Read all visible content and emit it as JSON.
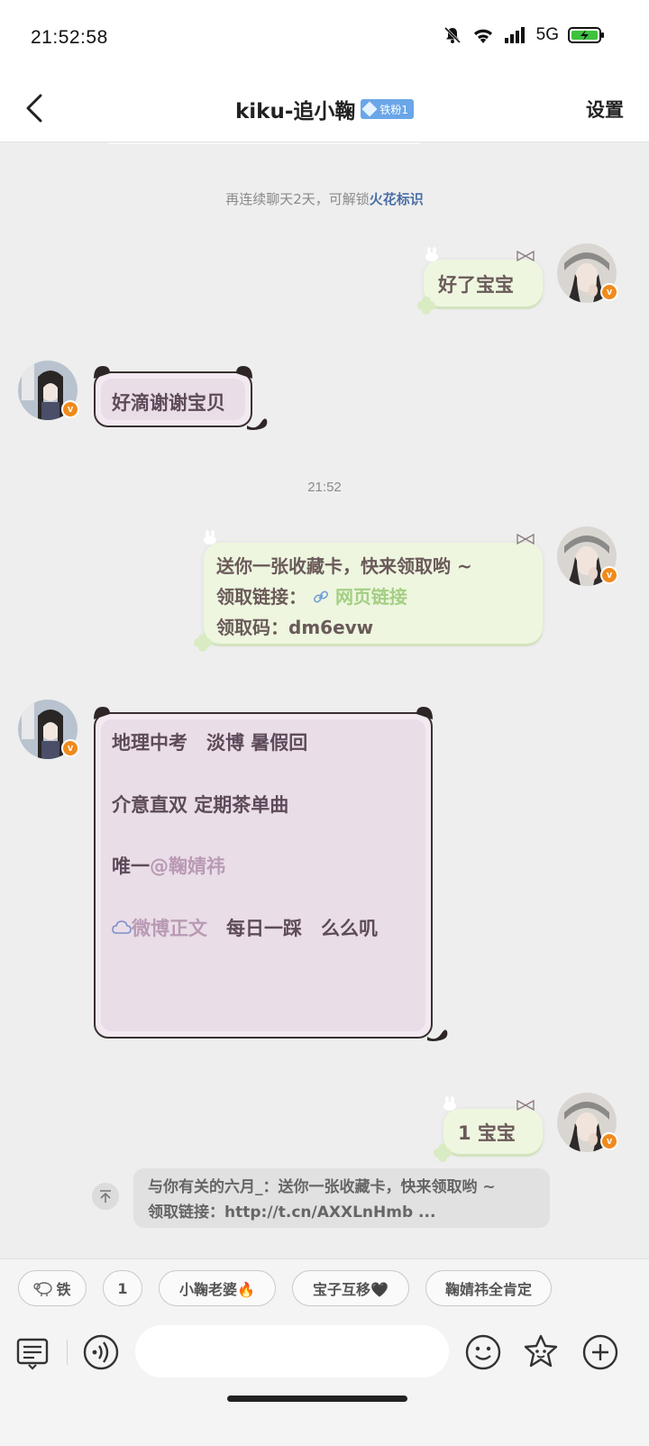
{
  "status_bar": {
    "time": "21:52:58",
    "network": "5G",
    "icons": [
      "mute-bell-icon",
      "wifi-icon",
      "signal-icon",
      "battery-charging-icon"
    ]
  },
  "nav": {
    "title": "kiku-追小鞠",
    "fan_badge": "铁粉1",
    "settings": "设置"
  },
  "system_hint": {
    "prefix": "再连续聊天2天，可解锁",
    "link": "火花标识"
  },
  "timestamp": "21:52",
  "messages": [
    {
      "side": "out",
      "text": "好了宝宝"
    },
    {
      "side": "in",
      "text": "好滴谢谢宝贝"
    },
    {
      "side": "out",
      "line1": "送你一张收藏卡，快来领取哟 ~",
      "line2_prefix": "领取链接：",
      "line2_link": "网页链接",
      "line3": "领取码：dm6evw"
    },
    {
      "side": "in",
      "line1": "地理中考　淡博  暑假回",
      "line2": "介意直双  定期茶单曲",
      "line3_prefix": "唯一",
      "line3_mention": "@鞠婧祎",
      "line4_link": "微博正文",
      "line4_rest": "　每日一踩　么么叽"
    },
    {
      "side": "out",
      "text": "1  宝宝"
    }
  ],
  "quote": {
    "line1": "与你有关的六月_：送你一张收藏卡，快来领取哟 ~",
    "line2": "领取链接：http://t.cn/AXXLnHmb  ..."
  },
  "quick_replies": [
    "铁",
    "1",
    "小鞠老婆🔥",
    "宝子互移🖤",
    "鞠婧祎全肯定"
  ],
  "colors": {
    "background": "#eeeeee",
    "out_bubble": "#eef6df",
    "in_bubble": "#e9dde8",
    "link_blue": "#4a6fa5",
    "verified_orange": "#f08a1c"
  }
}
